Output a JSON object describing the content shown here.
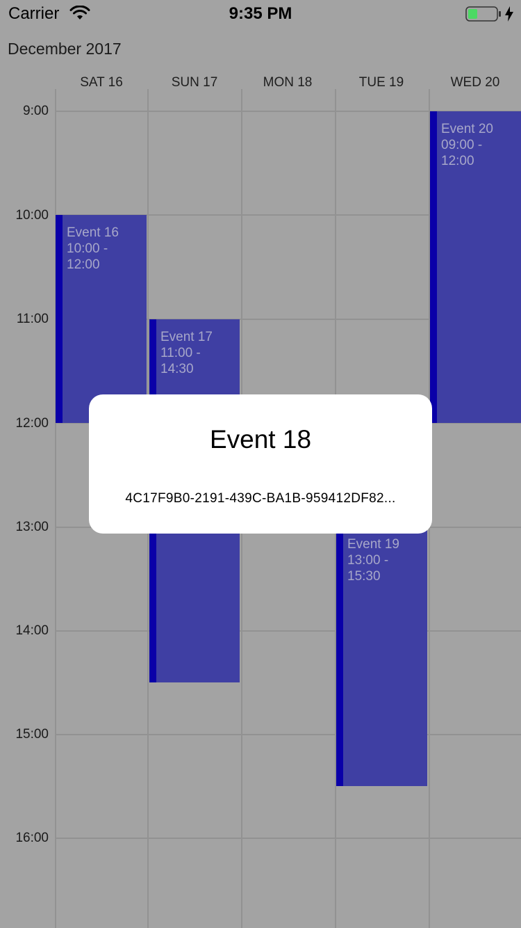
{
  "status_bar": {
    "carrier": "Carrier",
    "time": "9:35 PM",
    "battery_color": "#4cd964"
  },
  "calendar": {
    "month_title": "December 2017",
    "days": [
      "SAT 16",
      "SUN 17",
      "MON 18",
      "TUE 19",
      "WED 20"
    ],
    "hours": [
      "9:00",
      "10:00",
      "11:00",
      "12:00",
      "13:00",
      "14:00",
      "15:00",
      "16:00"
    ],
    "events": [
      {
        "title": "Event 16",
        "time": "10:00 -\n12:00"
      },
      {
        "title": "Event 17",
        "time": "11:00 -\n14:30"
      },
      {
        "title": "Event 19",
        "time": "13:00 -\n15:30"
      },
      {
        "title": "Event 20",
        "time": "09:00 -\n12:00"
      }
    ],
    "event_color": "#3f3fa3",
    "event_accent": "#0a00a8"
  },
  "popup": {
    "title": "Event 18",
    "subtitle": "4C17F9B0-2191-439C-BA1B-959412DF82..."
  }
}
